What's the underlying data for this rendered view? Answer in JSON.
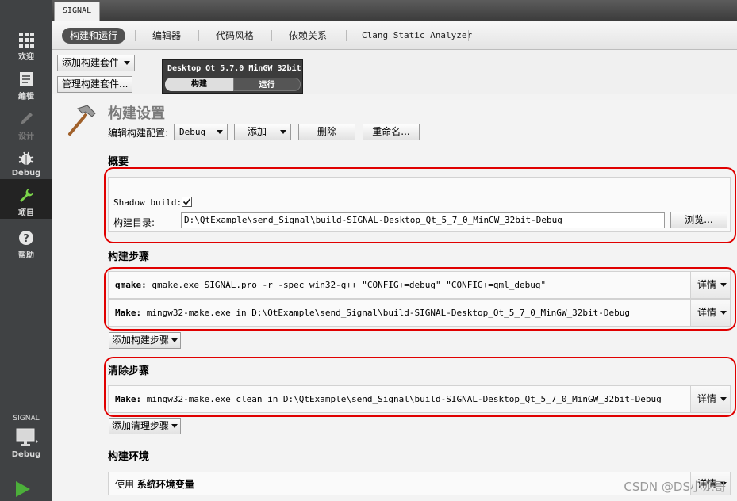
{
  "modebar": {
    "items": [
      {
        "label": "欢迎",
        "icon": "grid-icon"
      },
      {
        "label": "编辑",
        "icon": "document-icon"
      },
      {
        "label": "设计",
        "icon": "pen-icon"
      },
      {
        "label": "Debug",
        "icon": "bug-icon"
      },
      {
        "label": "项目",
        "icon": "wrench-icon"
      },
      {
        "label": "帮助",
        "icon": "help-icon"
      }
    ],
    "target_project": "SIGNAL",
    "target_config": "Debug"
  },
  "tabbar": {
    "project_tab": "SIGNAL"
  },
  "subtabs": [
    "构建和运行",
    "编辑器",
    "代码风格",
    "依赖关系",
    "Clang Static Analyzer"
  ],
  "kits": {
    "add_kit": "添加构建套件",
    "manage_kits": "管理构建套件...",
    "kit_name": "Desktop Qt 5.7.0 MinGW 32bit",
    "build_tab": "构建",
    "run_tab": "运行"
  },
  "build_settings": {
    "title": "构建设置",
    "edit_config_label": "编辑构建配置:",
    "config_value": "Debug",
    "add_button": "添加",
    "delete_button": "删除",
    "rename_button": "重命名..."
  },
  "general": {
    "title": "概要",
    "shadow_build_label": "Shadow build:",
    "shadow_build_checked": true,
    "build_dir_label": "构建目录:",
    "build_dir_value": "D:\\QtExample\\send_Signal\\build-SIGNAL-Desktop_Qt_5_7_0_MinGW_32bit-Debug",
    "browse_button": "浏览..."
  },
  "build_steps": {
    "title": "构建步骤",
    "steps": [
      {
        "name": "qmake:",
        "command": "qmake.exe SIGNAL.pro -r -spec win32-g++ \"CONFIG+=debug\" \"CONFIG+=qml_debug\"",
        "details": "详情"
      },
      {
        "name": "Make:",
        "command": "mingw32-make.exe in D:\\QtExample\\send_Signal\\build-SIGNAL-Desktop_Qt_5_7_0_MinGW_32bit-Debug",
        "details": "详情"
      }
    ],
    "add_step": "添加构建步骤"
  },
  "clean_steps": {
    "title": "清除步骤",
    "steps": [
      {
        "name": "Make:",
        "command": "mingw32-make.exe clean in D:\\QtExample\\send_Signal\\build-SIGNAL-Desktop_Qt_5_7_0_MinGW_32bit-Debug",
        "details": "详情"
      }
    ],
    "add_step": "添加清理步骤"
  },
  "build_env": {
    "title": "构建环境",
    "use_label": "使用",
    "env_name": "系统环境变量",
    "details": "详情"
  },
  "watermark": "CSDN @DS小龙哥",
  "colors": {
    "annotation_red": "#e00000",
    "active_mode": "#232323",
    "run_green": "#4caf3a"
  }
}
